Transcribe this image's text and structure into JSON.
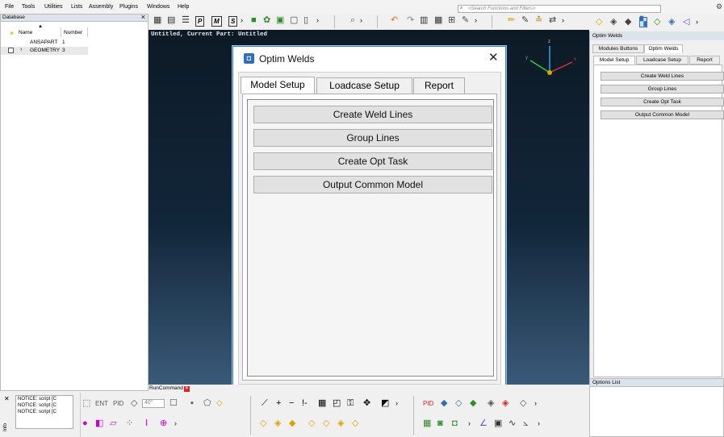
{
  "menubar": {
    "items": [
      "File",
      "Tools",
      "Utilities",
      "Lists",
      "Assembly",
      "Plugins",
      "Windows",
      "Help"
    ],
    "search_placeholder": "<Search Functions and Filters>"
  },
  "database": {
    "title": "Database",
    "col_name": "Name",
    "col_number": "Number",
    "rows": [
      {
        "name": "ANSAPART",
        "number": "1"
      },
      {
        "name": "GEOMETRY",
        "number": "3"
      }
    ]
  },
  "viewport": {
    "title": "Untitled,  Current Part: Untitled"
  },
  "dialog": {
    "title": "Optim Welds",
    "tabs": [
      "Model Setup",
      "Loadcase Setup",
      "Report"
    ],
    "buttons": [
      "Create Weld Lines",
      "Group Lines",
      "Create Opt Task",
      "Output Common Model"
    ]
  },
  "right_panel": {
    "title": "Optim Welds",
    "top_tabs": [
      "Modules Buttons",
      "Optim Welds"
    ],
    "tabs": [
      "Model Setup",
      "Loadcase Setup",
      "Report"
    ],
    "buttons": [
      "Create Weld Lines",
      "Group Lines",
      "Create Opt Task",
      "Output Common Model"
    ],
    "options_title": "Options List"
  },
  "bottom": {
    "runcommand_tab": "RunCommand",
    "info_label": "Info",
    "notices": [
      "NOTICE: script [C",
      "NOTICE: script [C",
      "NOTICE: script [C"
    ],
    "angle_value": "40°"
  },
  "colors": {
    "accent": "#2f6fb7",
    "viewport_top": "#0d1a26",
    "viewport_bottom": "#3a5a78"
  }
}
